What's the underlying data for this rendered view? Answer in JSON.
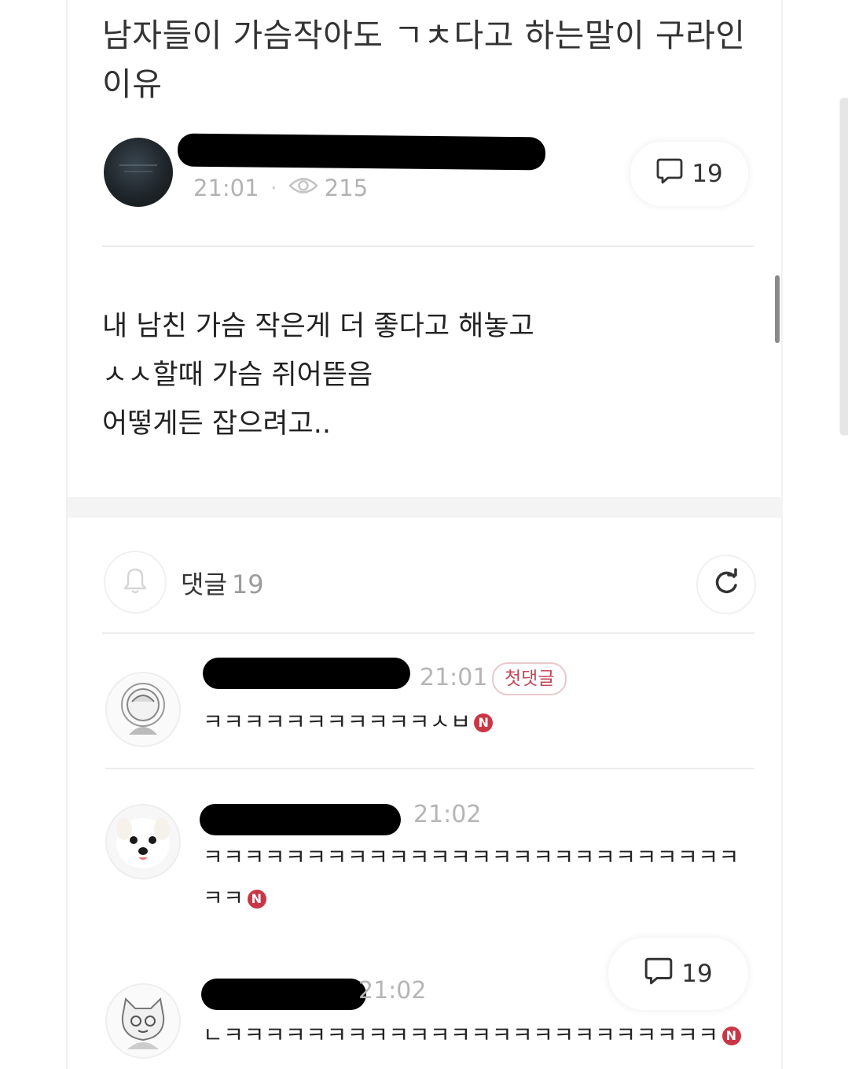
{
  "post": {
    "title": "남자들이 가슴작아도 ㄱㅊ다고 하는말이 구라인 이유",
    "time": "21:01",
    "views": "215",
    "comment_count": "19",
    "body_lines": [
      "내 남친 가슴 작은게 더 좋다고 해놓고",
      "ㅅㅅ할때 가슴 쥐어뜯음",
      "어떻게든 잡으려고.."
    ]
  },
  "comments_header": {
    "label": "댓글",
    "count": "19"
  },
  "comments": [
    {
      "time": "21:01",
      "badge": "첫댓글",
      "text": "ㅋㅋㅋㅋㅋㅋㅋㅋㅋㅋㅋㅅㅂ",
      "new": "N"
    },
    {
      "time": "21:02",
      "text_line1": "ㅋㅋㅋㅋㅋㅋㅋㅋㅋㅋㅋㅋㅋㅋㅋㅋㅋㅋㅋㅋㅋㅋㅋㅋㅋㅋ",
      "text_line2": "ㅋㅋ",
      "new": "N"
    },
    {
      "time": "21:02",
      "text": "ㄴㅋㅋㅋㅋㅋㅋㅋㅋㅋㅋㅋㅋㅋㅋㅋㅋㅋㅋㅋㅋㅋㅋㅋㅋ",
      "new": "N"
    }
  ],
  "floating_button": {
    "count": "19"
  },
  "icons": [
    "comment-bubble-icon",
    "eye-icon",
    "bell-icon",
    "refresh-icon",
    "new-badge-icon"
  ],
  "colors": {
    "accent_red": "#c93747",
    "muted_text": "#b3b3b3"
  }
}
